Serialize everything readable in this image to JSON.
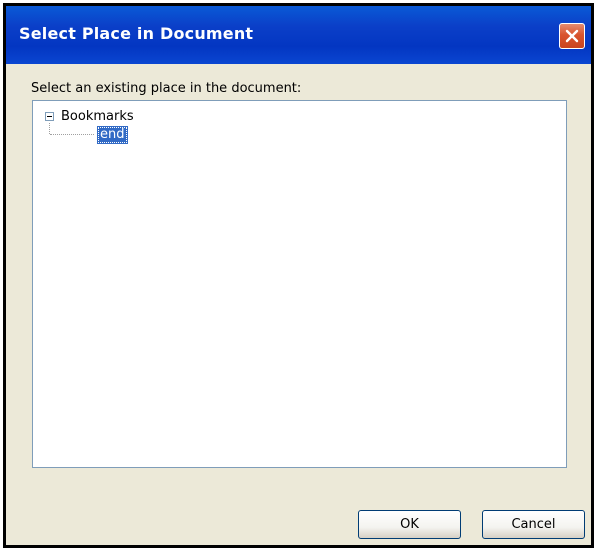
{
  "window": {
    "title": "Select Place in Document",
    "close_icon": "close-x-icon"
  },
  "prompt": "Select an existing place in the document:",
  "tree": {
    "root": {
      "label": "Bookmarks",
      "expanded": true,
      "expander_icon": "collapse-minus-icon",
      "children": [
        {
          "label": "end",
          "selected": true
        }
      ]
    }
  },
  "buttons": {
    "ok": "OK",
    "cancel": "Cancel"
  },
  "colors": {
    "titlebar": "#0a46d1",
    "dialog_bg": "#ece9d8",
    "selection": "#316ac5",
    "close_button": "#d9542e"
  }
}
